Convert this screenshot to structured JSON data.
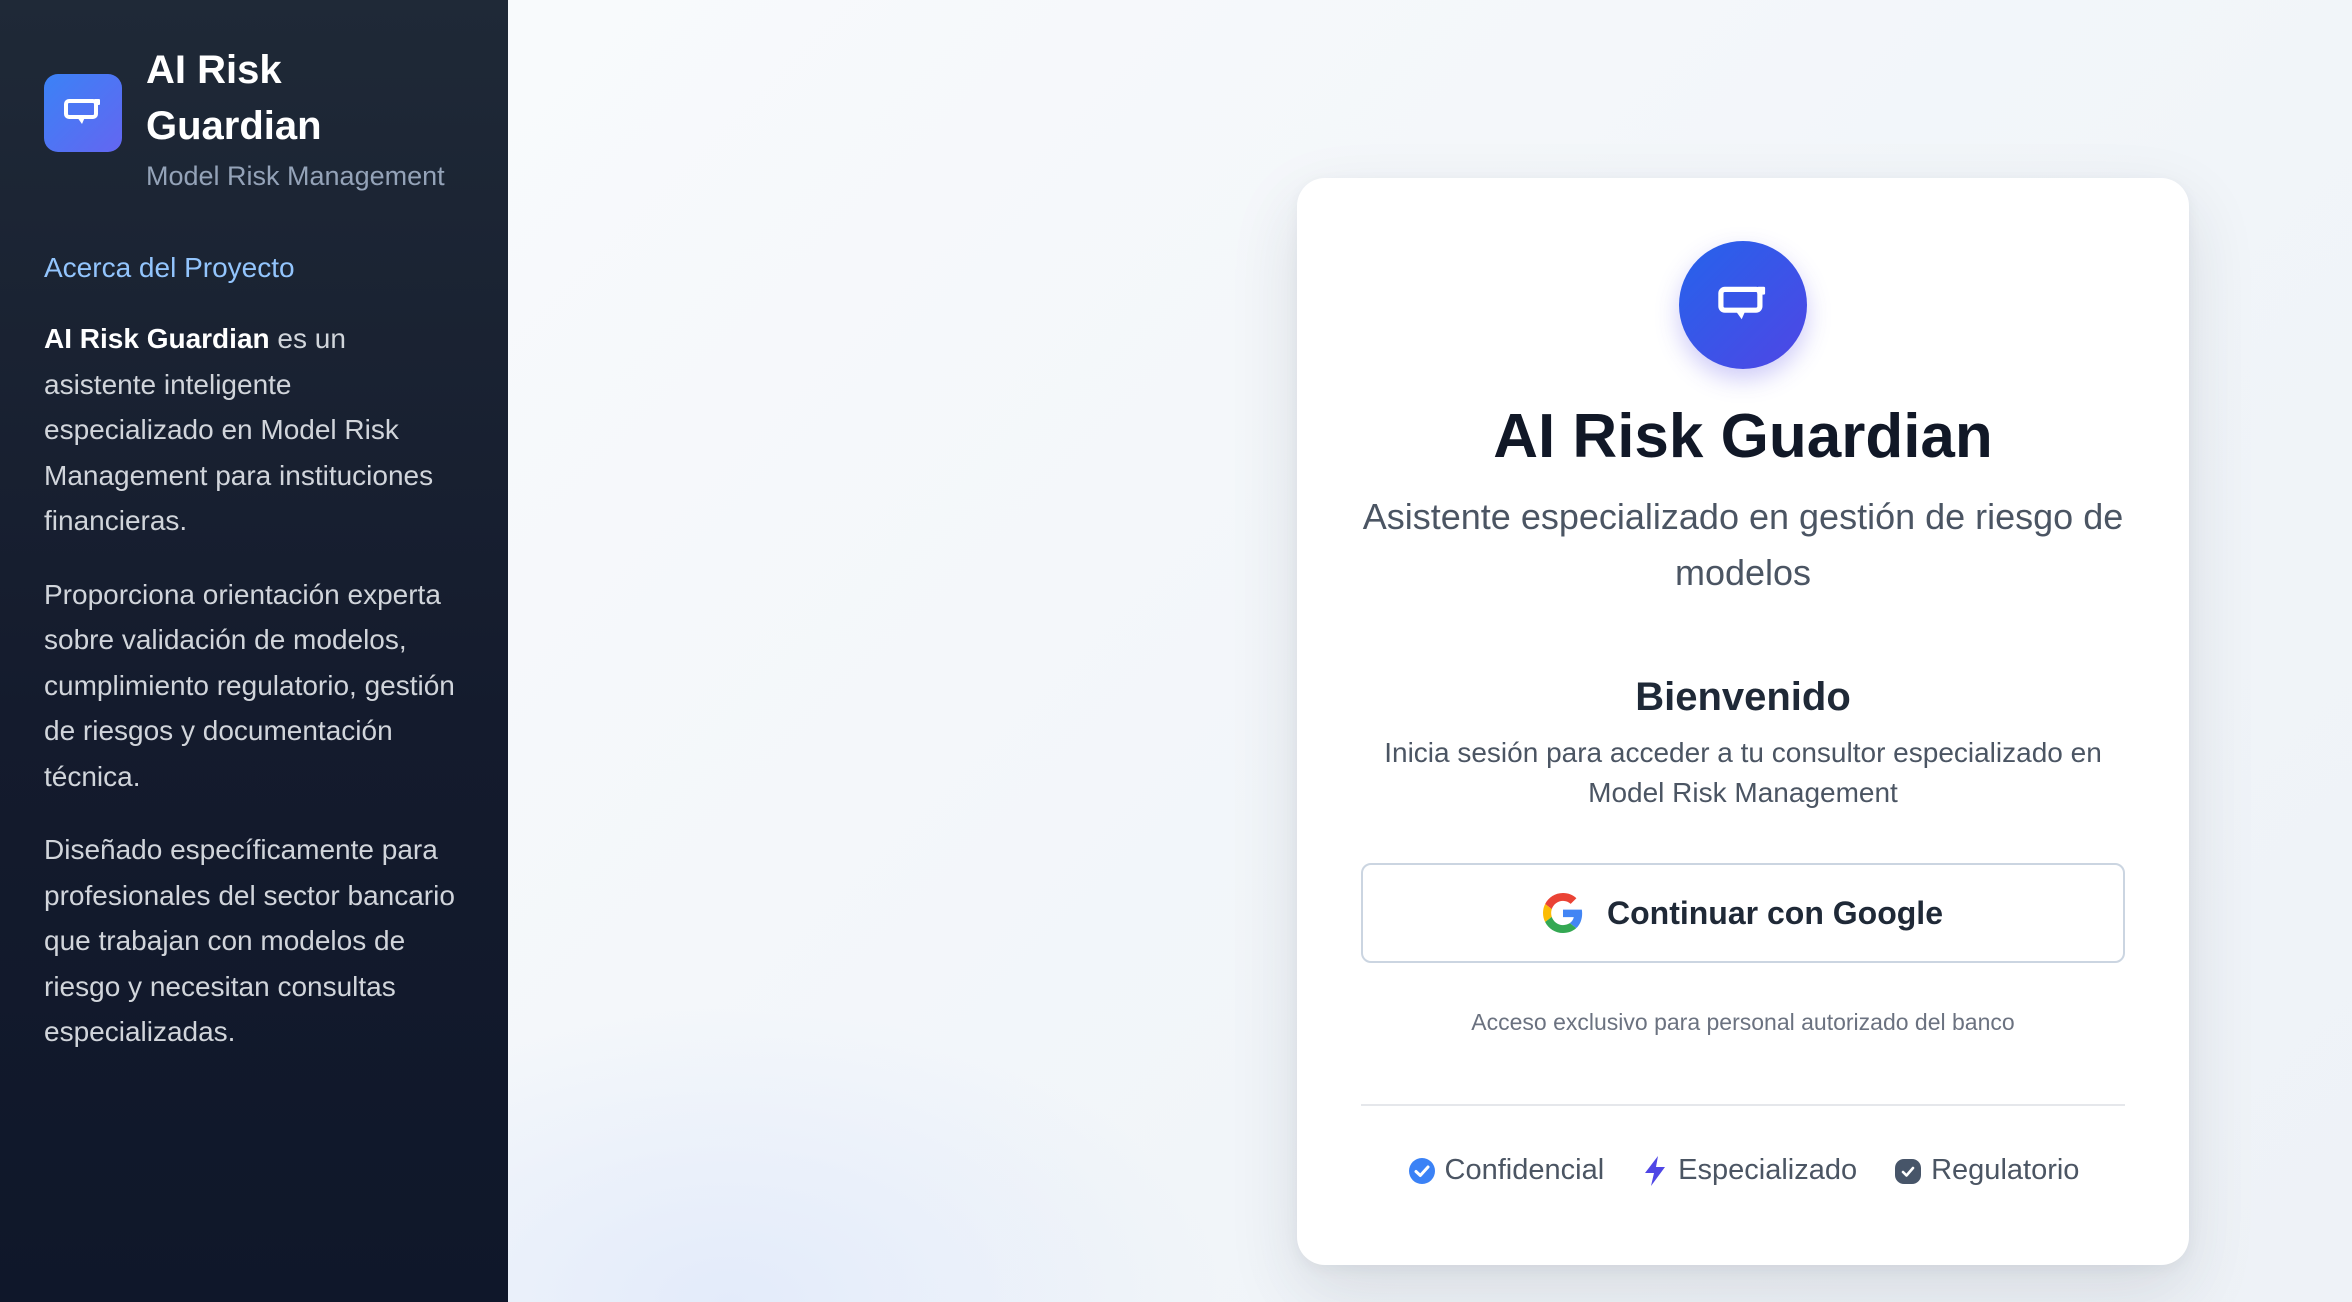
{
  "sidebar": {
    "brand_title": "AI Risk Guardian",
    "brand_subtitle": "Model Risk Management",
    "about_heading": "Acerca del Proyecto",
    "about_bold": "AI Risk Guardian",
    "about_p1_rest": " es un asistente inteligente especializado en Model Risk Management para instituciones financieras.",
    "about_p2": "Proporciona orientación experta sobre validación de modelos, cumplimiento regulatorio, gestión de riesgos y documentación técnica.",
    "about_p3": "Diseñado específicamente para profesionales del sector bancario que trabajan con modelos de riesgo y necesitan consultas especializadas."
  },
  "card": {
    "title": "AI Risk Guardian",
    "subtitle": "Asistente especializado en gestión de riesgo de modelos",
    "welcome_title": "Bienvenido",
    "welcome_text": "Inicia sesión para acceder a tu consultor especializado en Model Risk Management",
    "google_button_label": "Continuar con Google",
    "access_note": "Acceso exclusivo para personal autorizado del banco",
    "badges": [
      {
        "label": "Confidencial",
        "icon": "check-circle-icon"
      },
      {
        "label": "Especializado",
        "icon": "lightning-bolt-icon"
      },
      {
        "label": "Regulatorio",
        "icon": "shield-check-icon"
      }
    ]
  },
  "colors": {
    "sidebar_bg": "#1f2937",
    "accent_blue": "#3b82f6",
    "accent_indigo": "#4f46e5",
    "link_blue": "#93c5fd"
  }
}
